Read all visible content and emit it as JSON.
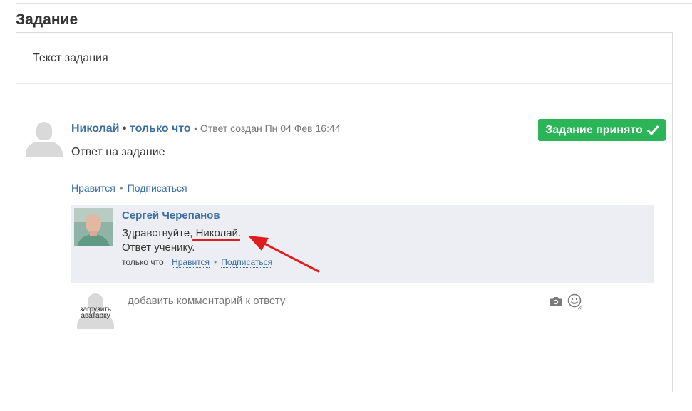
{
  "section": {
    "title": "Задание"
  },
  "task": {
    "text": "Текст задания"
  },
  "answer": {
    "author": "Николай",
    "separator": "•",
    "time": "только что",
    "meta": "• Ответ создан Пн 04 Фев 16:44",
    "text": "Ответ на задание",
    "accepted_label": "Задание принято",
    "like_label": "Нравится",
    "subscribe_label": "Подписаться",
    "dot": "•"
  },
  "comment": {
    "author": "Сергей Черепанов",
    "greeting": "Здравствуйте,",
    "name_highlight": "Николай.",
    "line2": "Ответ ученику.",
    "time": "только что",
    "like_label": "Нравится",
    "subscribe_label": "Подписаться",
    "dot": "•"
  },
  "comment_form": {
    "placeholder": "добавить комментарий к ответу",
    "upload_avatar_label": "загрузить аватарку"
  },
  "colors": {
    "accent": "#3a6ea5",
    "accepted": "#2cb558",
    "annotation": "#e01d1d",
    "comment_bg": "#eceef3"
  },
  "icons": [
    "default-avatar-icon",
    "check-icon",
    "camera-icon",
    "smile-icon",
    "resize-handle-icon",
    "annotation-arrow-icon"
  ]
}
